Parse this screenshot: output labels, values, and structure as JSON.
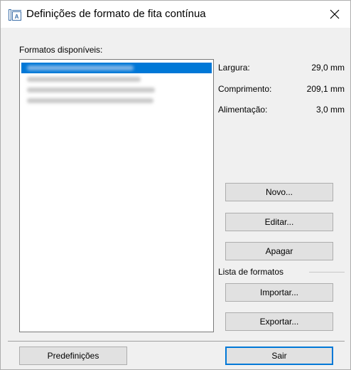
{
  "window": {
    "title": "Definições de formato de fita contínua",
    "close_glyph": "✕"
  },
  "formats": {
    "label": "Formatos disponíveis:",
    "items": [
      {
        "text": "",
        "selected": true
      },
      {
        "text": "",
        "selected": false
      },
      {
        "text": "",
        "selected": false
      },
      {
        "text": "",
        "selected": false
      }
    ]
  },
  "properties": {
    "width_label": "Largura:",
    "width_value": "29,0 mm",
    "length_label": "Comprimento:",
    "length_value": "209,1 mm",
    "feed_label": "Alimentação:",
    "feed_value": "3,0 mm"
  },
  "buttons": {
    "new": "Novo...",
    "edit": "Editar...",
    "delete": "Apagar",
    "import": "Importar...",
    "export": "Exportar...",
    "presets": "Predefinições",
    "exit": "Sair"
  },
  "format_list_group": {
    "label": "Lista de formatos"
  },
  "colors": {
    "selection": "#0078d7",
    "default_button_border": "#0078d7"
  },
  "icons": {
    "title": "tape-format-icon",
    "close": "close-icon"
  }
}
